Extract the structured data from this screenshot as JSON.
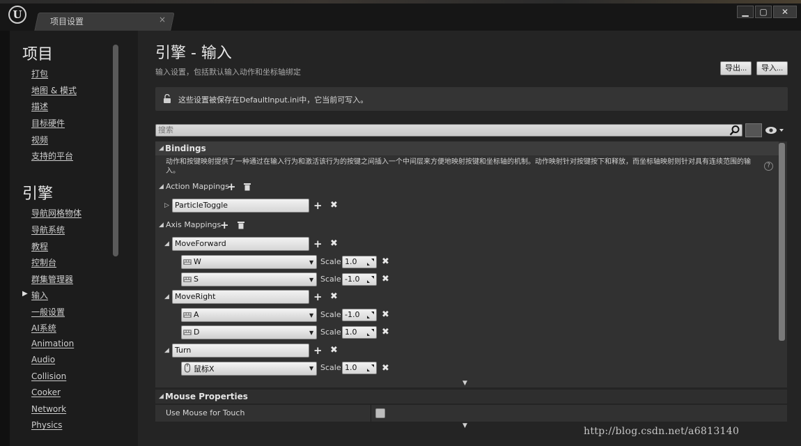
{
  "window": {
    "logo": "U",
    "tab_title": "项目设置",
    "tab_close": "×",
    "min": "▁",
    "max": "▢",
    "close": "✕"
  },
  "sidebar": {
    "project_title": "项目",
    "project_items": [
      "打包",
      "地图 & 模式",
      "描述",
      "目标硬件",
      "视频",
      "支持的平台"
    ],
    "engine_title": "引擎",
    "engine_items": [
      "导航网格物体",
      "导航系统",
      "教程",
      "控制台",
      "群集管理器",
      "输入",
      "一般设置",
      "AI系统",
      "Animation",
      "Audio",
      "Collision",
      "Cooker",
      "Network",
      "Physics"
    ],
    "selected": "输入"
  },
  "header": {
    "title": "引擎 - 输入",
    "subtitle": "输入设置，包括默认输入动作和坐标轴绑定",
    "export_label": "导出...",
    "import_label": "导入..."
  },
  "notice": {
    "text": "这些设置被保存在DefaultInput.ini中，它当前可写入。",
    "icon": "lock-open-icon"
  },
  "search": {
    "placeholder": "搜索",
    "value": ""
  },
  "bindings": {
    "title": "Bindings",
    "description": "动作和按键映射提供了一种通过在输入行为和激活该行为的按键之间插入一个中间层来方便地映射按键和坐标轴的机制。动作映射针对按键按下和释放，而坐标轴映射则针对具有连续范围的输入。",
    "action_label": "Action Mappings",
    "actions": [
      {
        "name": "ParticleToggle"
      }
    ],
    "axis_label": "Axis Mappings",
    "scale_label": "Scale",
    "axes": [
      {
        "name": "MoveForward",
        "keys": [
          {
            "key": "W",
            "scale": "1.0"
          },
          {
            "key": "S",
            "scale": "-1.0"
          }
        ]
      },
      {
        "name": "MoveRight",
        "keys": [
          {
            "key": "A",
            "scale": "-1.0"
          },
          {
            "key": "D",
            "scale": "1.0"
          }
        ]
      },
      {
        "name": "Turn",
        "keys": [
          {
            "key": "鼠标X",
            "scale": "1.0",
            "icon": "mouse-icon"
          }
        ]
      }
    ]
  },
  "mouse_properties": {
    "title": "Mouse Properties",
    "use_mouse_for_touch": "Use Mouse for Touch",
    "checked": false
  },
  "watermark": "http://blog.csdn.net/a6813140",
  "colors": {
    "panel": "#242424",
    "sidebar": "#1c1c1c",
    "field": "#e2e2e2"
  }
}
